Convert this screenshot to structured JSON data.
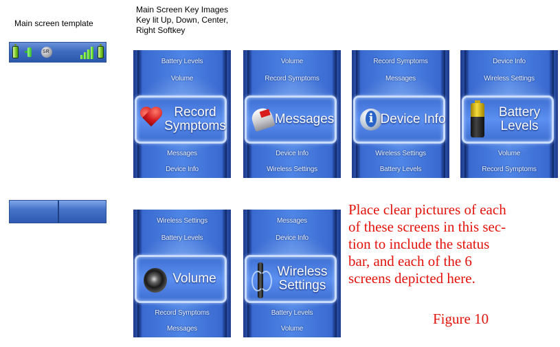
{
  "template_label": "Main screen template",
  "key_images_label": [
    "Main Screen Key Images",
    "Key lit Up, Down, Center,",
    "Right Softkey"
  ],
  "screens": [
    {
      "above": [
        "Battery Levels",
        "Volume"
      ],
      "selected": [
        "Record",
        "Symptoms"
      ],
      "below": [
        "Messages",
        "Device Info"
      ],
      "icon": "heart-icon"
    },
    {
      "above": [
        "Volume",
        "Record Symptoms"
      ],
      "selected": [
        "Messages"
      ],
      "below": [
        "Device Info",
        "Wireless Settings"
      ],
      "icon": "mailbox-icon"
    },
    {
      "above": [
        "Record Symptoms",
        "Messages"
      ],
      "selected": [
        "Device Info"
      ],
      "below": [
        "Wireless Settings",
        "Battery Levels"
      ],
      "icon": "info-icon"
    },
    {
      "above": [
        "Device Info",
        "Wireless Settings"
      ],
      "selected": [
        "Battery",
        "Levels"
      ],
      "below": [
        "Volume",
        "Record Symptoms"
      ],
      "icon": "battery-icon"
    },
    {
      "above": [
        "Wireless Settings",
        "Battery Levels"
      ],
      "selected": [
        "Volume"
      ],
      "below": [
        "Record Symptoms",
        "Messages"
      ],
      "icon": "speaker-icon"
    },
    {
      "above": [
        "Messages",
        "Device Info"
      ],
      "selected": [
        "Wireless",
        "Settings"
      ],
      "below": [
        "Battery Levels",
        "Volume"
      ],
      "icon": "wireless-icon"
    }
  ],
  "note_lines": [
    "Place clear pictures of each",
    "of these screens in this sec-",
    "tion to include the status",
    "bar, and each of the 6",
    "screens depicted here."
  ],
  "figure_label": "Figure 10",
  "colors": {
    "note": "#e3120b",
    "screen_blue": "#4f86e6",
    "status_green": "#36bb1a"
  }
}
